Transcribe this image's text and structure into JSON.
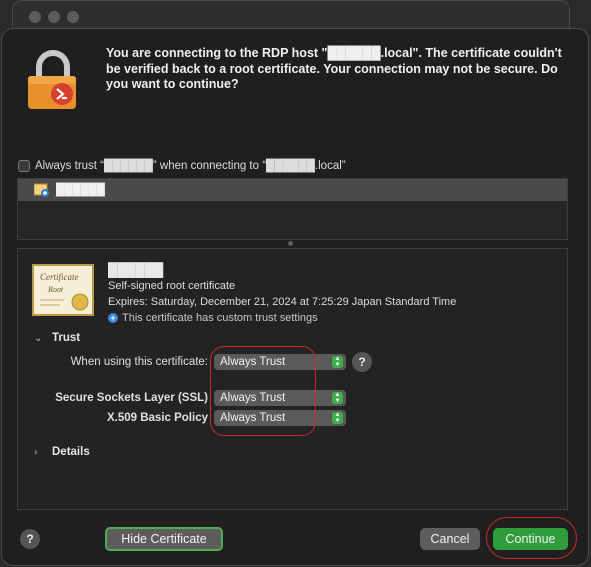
{
  "message": "You are connecting to the RDP host \"██████.local\". The certificate couldn't be verified back to a root certificate. Your connection may not be secure. Do you want to continue?",
  "always_trust": {
    "checked": false,
    "label": "Always trust “██████” when connecting to “██████.local”"
  },
  "chain": {
    "selected_item": "██████"
  },
  "certificate": {
    "common_name": "██████",
    "type": "Self-signed root certificate",
    "expires": "Expires: Saturday, December 21, 2024 at 7:25:29 Japan Standard Time",
    "custom_trust_note": "This certificate has custom trust settings",
    "image_text_1": "Certificate",
    "image_text_2": "Root"
  },
  "trust": {
    "section_label": "Trust",
    "when_using_label": "When using this certificate:",
    "when_using_value": "Always Trust",
    "ssl_label": "Secure Sockets Layer (SSL)",
    "ssl_value": "Always Trust",
    "x509_label": "X.509 Basic Policy",
    "x509_value": "Always Trust"
  },
  "details_section_label": "Details",
  "buttons": {
    "help": "?",
    "hide_certificate": "Hide Certificate",
    "cancel": "Cancel",
    "continue": "Continue"
  },
  "colors": {
    "primary_button": "#2f9e3a",
    "annotation": "#c62a2a",
    "info_badge": "#3b8cde"
  }
}
